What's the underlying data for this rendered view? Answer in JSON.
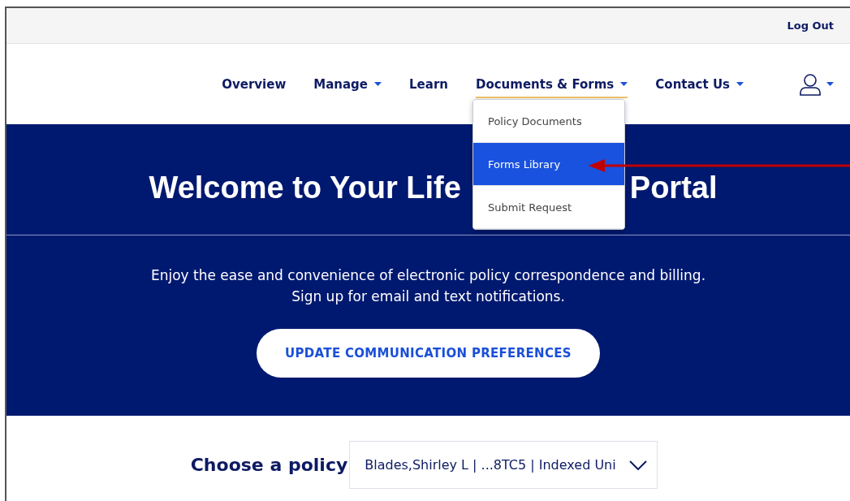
{
  "top_bar": {
    "logout": "Log Out"
  },
  "nav": {
    "items": [
      {
        "label": "Overview",
        "has_menu": false,
        "expanded": false
      },
      {
        "label": "Manage",
        "has_menu": true,
        "expanded": false
      },
      {
        "label": "Learn",
        "has_menu": false,
        "expanded": false
      },
      {
        "label": "Documents & Forms",
        "has_menu": true,
        "expanded": true
      },
      {
        "label": "Contact Us",
        "has_menu": true,
        "expanded": false
      }
    ],
    "menu": [
      {
        "label": "Policy Documents",
        "selected": false
      },
      {
        "label": "Forms Library",
        "selected": true
      },
      {
        "label": "Submit Request",
        "selected": false
      }
    ]
  },
  "banner": {
    "title_parts": [
      "Welcome to Your Life",
      "Portal"
    ],
    "lines": [
      "Enjoy the ease and convenience of electronic policy correspondence and billing.",
      "Sign up for email and text notifications."
    ],
    "button": "UPDATE COMMUNICATION PREFERENCES"
  },
  "policy": {
    "label": "Choose a policy",
    "value": "Blades,Shirley L | ...8TC5 | Indexed Uni"
  }
}
